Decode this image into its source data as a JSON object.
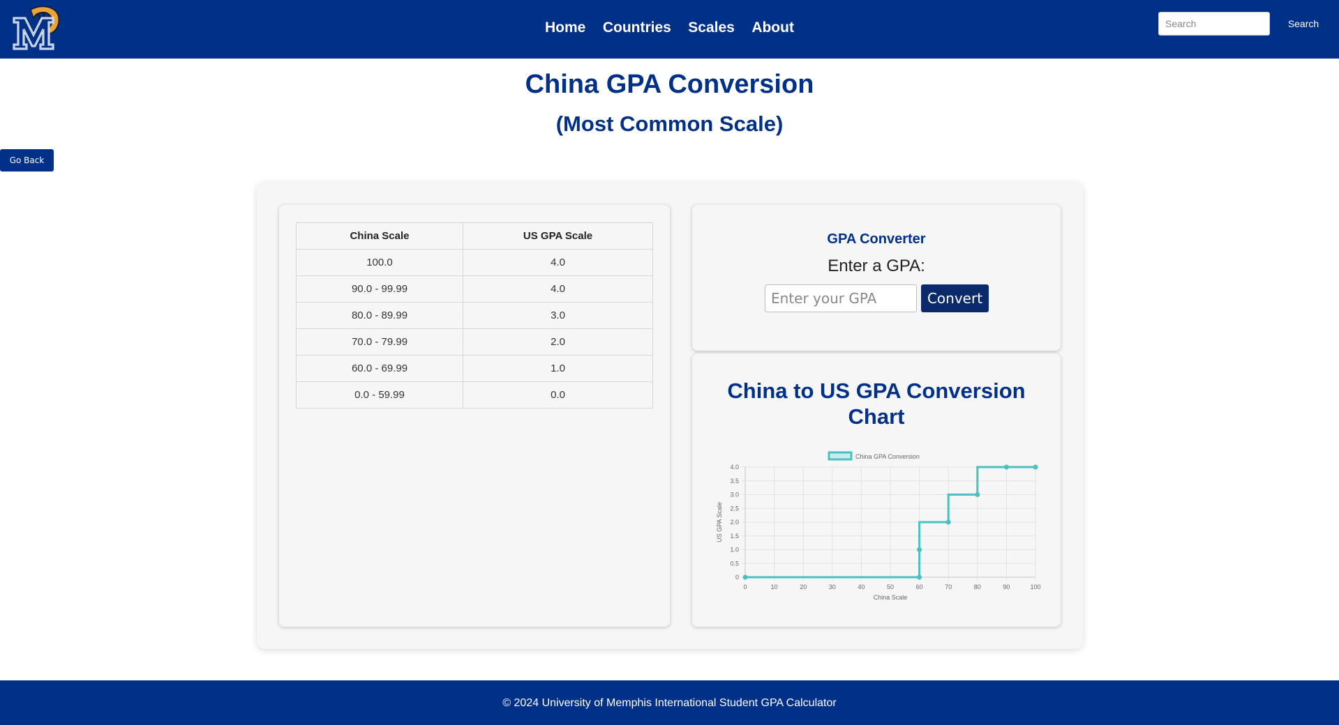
{
  "header": {
    "logo_icon": "memphis-tiger-logo",
    "nav": [
      "Home",
      "Countries",
      "Scales",
      "About"
    ],
    "search_placeholder": "Search",
    "search_button": "Search",
    "background_color": "#003087"
  },
  "page": {
    "title": "China GPA Conversion",
    "subtitle": "(Most Common Scale)",
    "go_back": "Go Back"
  },
  "table": {
    "headers": [
      "China Scale",
      "US GPA Scale"
    ],
    "rows": [
      [
        "100.0",
        "4.0"
      ],
      [
        "90.0 - 99.99",
        "4.0"
      ],
      [
        "80.0 - 89.99",
        "3.0"
      ],
      [
        "70.0 - 79.99",
        "2.0"
      ],
      [
        "60.0 - 69.99",
        "1.0"
      ],
      [
        "0.0 - 59.99",
        "0.0"
      ]
    ]
  },
  "converter": {
    "heading": "GPA Converter",
    "label": "Enter a GPA:",
    "input_placeholder": "Enter your GPA",
    "button": "Convert"
  },
  "chart_heading": "China to US GPA Conversion Chart",
  "chart_data": {
    "type": "line",
    "stepped": true,
    "series": [
      {
        "name": "China GPA Conversion",
        "color": "#4bc0c0",
        "points": [
          [
            0,
            0
          ],
          [
            60,
            0
          ],
          [
            60,
            1
          ],
          [
            70,
            2
          ],
          [
            80,
            3
          ],
          [
            90,
            4
          ],
          [
            100,
            4
          ]
        ]
      }
    ],
    "xlabel": "China Scale",
    "ylabel": "US GPA Scale",
    "xlim": [
      0,
      100
    ],
    "ylim": [
      0,
      4
    ],
    "x_ticks": [
      "0",
      "10",
      "20",
      "30",
      "40",
      "50",
      "60",
      "70",
      "80",
      "90",
      "100"
    ],
    "y_ticks": [
      "0",
      "0.5",
      "1.0",
      "1.5",
      "2.0",
      "2.5",
      "3.0",
      "3.5",
      "4.0"
    ],
    "grid": true,
    "legend_position": "top"
  },
  "footer": {
    "text": "© 2024 University of Memphis International Student GPA Calculator"
  },
  "colors": {
    "brand_blue": "#003087",
    "button_dark": "#0a2a6b",
    "series_teal": "#4bc0c0"
  }
}
